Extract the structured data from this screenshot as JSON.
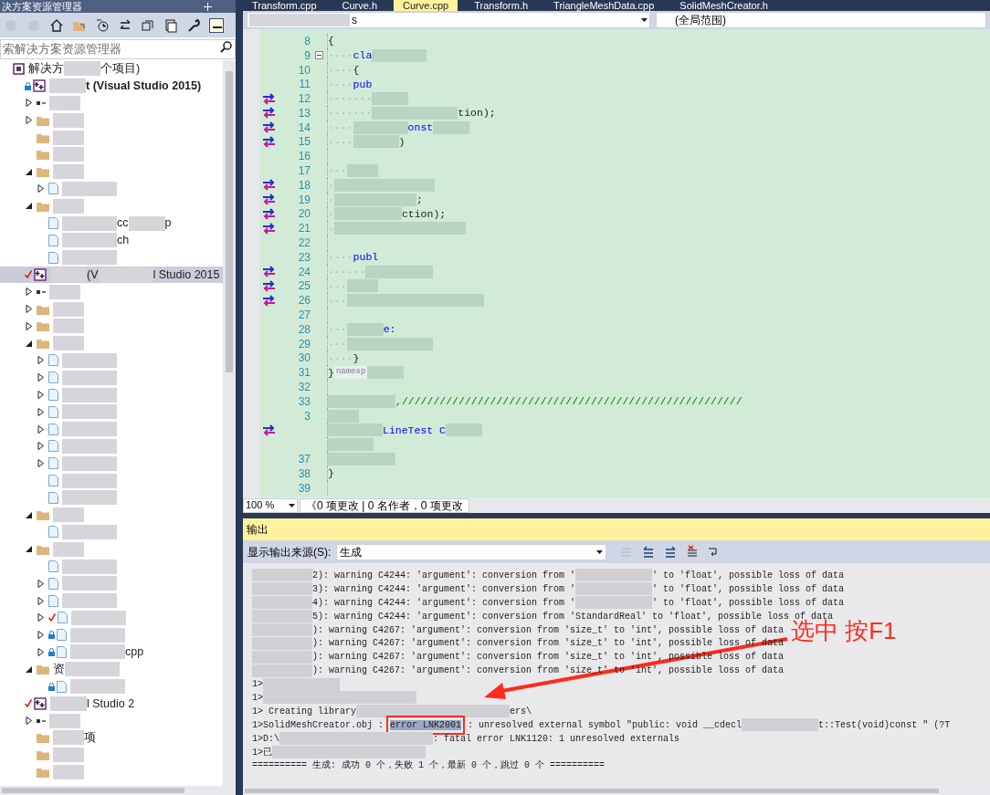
{
  "explorer": {
    "title": "决方案资源管理器",
    "search": {
      "placeholder": "索解决方案资源管理器"
    },
    "tree": [
      {
        "kind": "solution",
        "selected": false,
        "locked": false,
        "checked": false,
        "segments": [
          {
            "kind": "text",
            "text": "解决方"
          },
          {
            "kind": "redacted"
          },
          {
            "kind": "text",
            "text": "个项目)"
          }
        ],
        "children": [
          {
            "kind": "project",
            "locked": true,
            "checked": false,
            "bold": true,
            "selected": false,
            "segments": [
              {
                "kind": "redacted"
              },
              {
                "kind": "text",
                "text": "t (Visual Studio 2015)"
              }
            ],
            "children": [
              {
                "kind": "ref",
                "expanded": false,
                "selected": false,
                "locked": false,
                "checked": false,
                "segments": [
                  {
                    "kind": "redacted"
                  }
                ]
              },
              {
                "kind": "folder",
                "expanded": false,
                "selected": false,
                "locked": false,
                "checked": false,
                "segments": [
                  {
                    "kind": "redacted"
                  }
                ]
              },
              {
                "kind": "folder",
                "selected": false,
                "locked": false,
                "checked": false,
                "segments": [
                  {
                    "kind": "redacted"
                  }
                ]
              },
              {
                "kind": "folder",
                "selected": false,
                "locked": false,
                "checked": false,
                "segments": [
                  {
                    "kind": "redacted"
                  }
                ]
              },
              {
                "kind": "folder",
                "expanded": true,
                "selected": false,
                "locked": false,
                "checked": false,
                "segments": [
                  {
                    "kind": "redacted"
                  }
                ],
                "children": [
                  {
                    "kind": "file",
                    "expanded": false,
                    "selected": false,
                    "locked": false,
                    "checked": false,
                    "segments": [
                      {
                        "kind": "redacted"
                      }
                    ]
                  }
                ]
              },
              {
                "kind": "folder",
                "expanded": true,
                "selected": false,
                "locked": false,
                "checked": false,
                "segments": [
                  {
                    "kind": "redacted"
                  }
                ],
                "children": [
                  {
                    "kind": "file",
                    "selected": false,
                    "locked": false,
                    "checked": false,
                    "segments": [
                      {
                        "kind": "redacted"
                      },
                      {
                        "kind": "text",
                        "text": "cc"
                      },
                      {
                        "kind": "redacted"
                      },
                      {
                        "kind": "text",
                        "text": "p"
                      }
                    ]
                  },
                  {
                    "kind": "file",
                    "selected": false,
                    "locked": false,
                    "checked": false,
                    "segments": [
                      {
                        "kind": "redacted"
                      },
                      {
                        "kind": "text",
                        "text": "ch"
                      }
                    ]
                  },
                  {
                    "kind": "file",
                    "selected": false,
                    "locked": false,
                    "checked": false,
                    "segments": [
                      {
                        "kind": "redacted"
                      }
                    ]
                  }
                ]
              }
            ]
          },
          {
            "kind": "project",
            "locked": false,
            "checked": true,
            "bold": false,
            "selected": true,
            "segments": [
              {
                "kind": "redacted"
              },
              {
                "kind": "text",
                "text": "(V"
              },
              {
                "kind": "redacted"
              },
              {
                "kind": "text",
                "text": "l Studio 2015"
              }
            ],
            "children": [
              {
                "kind": "ref",
                "expanded": false,
                "selected": false,
                "locked": false,
                "checked": false,
                "segments": [
                  {
                    "kind": "redacted"
                  }
                ]
              },
              {
                "kind": "folder",
                "expanded": false,
                "selected": false,
                "locked": false,
                "checked": false,
                "segments": [
                  {
                    "kind": "redacted"
                  }
                ]
              },
              {
                "kind": "folder",
                "expanded": false,
                "selected": false,
                "locked": false,
                "checked": false,
                "segments": [
                  {
                    "kind": "redacted"
                  }
                ]
              },
              {
                "kind": "folder",
                "expanded": true,
                "selected": false,
                "locked": false,
                "checked": false,
                "segments": [
                  {
                    "kind": "redacted"
                  }
                ],
                "children": [
                  {
                    "kind": "file",
                    "expanded": false,
                    "selected": false,
                    "locked": false,
                    "checked": false,
                    "segments": [
                      {
                        "kind": "redacted"
                      }
                    ]
                  },
                  {
                    "kind": "file",
                    "expanded": false,
                    "selected": false,
                    "locked": false,
                    "checked": false,
                    "segments": [
                      {
                        "kind": "redacted"
                      }
                    ]
                  },
                  {
                    "kind": "file",
                    "expanded": false,
                    "selected": false,
                    "locked": false,
                    "checked": false,
                    "segments": [
                      {
                        "kind": "redacted"
                      }
                    ]
                  },
                  {
                    "kind": "file",
                    "expanded": false,
                    "selected": false,
                    "locked": false,
                    "checked": false,
                    "segments": [
                      {
                        "kind": "redacted"
                      }
                    ]
                  },
                  {
                    "kind": "file",
                    "expanded": false,
                    "selected": false,
                    "locked": false,
                    "checked": false,
                    "segments": [
                      {
                        "kind": "redacted"
                      }
                    ]
                  },
                  {
                    "kind": "file",
                    "expanded": false,
                    "selected": false,
                    "locked": false,
                    "checked": false,
                    "segments": [
                      {
                        "kind": "redacted"
                      }
                    ]
                  },
                  {
                    "kind": "file",
                    "expanded": false,
                    "selected": false,
                    "locked": false,
                    "checked": false,
                    "segments": [
                      {
                        "kind": "redacted"
                      }
                    ]
                  },
                  {
                    "kind": "file",
                    "selected": false,
                    "locked": false,
                    "checked": false,
                    "segments": [
                      {
                        "kind": "redacted"
                      }
                    ]
                  },
                  {
                    "kind": "file",
                    "selected": false,
                    "locked": false,
                    "checked": false,
                    "segments": [
                      {
                        "kind": "redacted"
                      }
                    ]
                  }
                ]
              },
              {
                "kind": "folder",
                "expanded": true,
                "selected": false,
                "locked": false,
                "checked": false,
                "segments": [
                  {
                    "kind": "redacted"
                  }
                ],
                "children": [
                  {
                    "kind": "file",
                    "selected": false,
                    "locked": false,
                    "checked": false,
                    "segments": [
                      {
                        "kind": "redacted"
                      }
                    ]
                  }
                ]
              },
              {
                "kind": "folder",
                "expanded": true,
                "selected": false,
                "locked": false,
                "checked": false,
                "segments": [
                  {
                    "kind": "redacted"
                  }
                ],
                "children": [
                  {
                    "kind": "file",
                    "selected": false,
                    "locked": false,
                    "checked": false,
                    "segments": [
                      {
                        "kind": "redacted"
                      }
                    ]
                  },
                  {
                    "kind": "file",
                    "expanded": false,
                    "selected": false,
                    "locked": false,
                    "checked": false,
                    "segments": [
                      {
                        "kind": "redacted"
                      }
                    ]
                  },
                  {
                    "kind": "file",
                    "expanded": false,
                    "selected": false,
                    "locked": false,
                    "checked": false,
                    "segments": [
                      {
                        "kind": "redacted"
                      }
                    ]
                  },
                  {
                    "kind": "file",
                    "expanded": false,
                    "checked": true,
                    "locked": false,
                    "selected": false,
                    "segments": [
                      {
                        "kind": "redacted"
                      }
                    ]
                  },
                  {
                    "kind": "file",
                    "expanded": false,
                    "locked": true,
                    "checked": false,
                    "selected": false,
                    "segments": [
                      {
                        "kind": "redacted"
                      }
                    ]
                  },
                  {
                    "kind": "file",
                    "expanded": false,
                    "locked": true,
                    "checked": false,
                    "selected": false,
                    "segments": [
                      {
                        "kind": "redacted"
                      },
                      {
                        "kind": "text",
                        "text": "cpp"
                      }
                    ]
                  }
                ]
              },
              {
                "kind": "folder",
                "expanded": true,
                "selected": false,
                "locked": false,
                "checked": false,
                "segments": [
                  {
                    "kind": "text",
                    "text": "资"
                  },
                  {
                    "kind": "redacted"
                  }
                ],
                "children": [
                  {
                    "kind": "file",
                    "locked": true,
                    "checked": false,
                    "selected": false,
                    "segments": [
                      {
                        "kind": "redacted"
                      }
                    ]
                  }
                ]
              }
            ]
          },
          {
            "kind": "project",
            "locked": false,
            "checked": true,
            "bold": false,
            "selected": false,
            "segments": [
              {
                "kind": "redacted"
              },
              {
                "kind": "text",
                "text": "l Studio 2"
              }
            ],
            "children": [
              {
                "kind": "ref",
                "expanded": false,
                "selected": false,
                "locked": false,
                "checked": false,
                "segments": [
                  {
                    "kind": "redacted"
                  }
                ]
              },
              {
                "kind": "folder",
                "selected": false,
                "locked": false,
                "checked": false,
                "segments": [
                  {
                    "kind": "redacted"
                  },
                  {
                    "kind": "text",
                    "text": "项"
                  }
                ]
              },
              {
                "kind": "folder",
                "selected": false,
                "locked": false,
                "checked": false,
                "segments": [
                  {
                    "kind": "redacted"
                  }
                ]
              },
              {
                "kind": "folder",
                "selected": false,
                "locked": false,
                "checked": false,
                "segments": [
                  {
                    "kind": "redacted"
                  }
                ]
              }
            ]
          }
        ]
      }
    ]
  },
  "editor": {
    "tabs": [
      {
        "label": "Transform.cpp",
        "selected": false
      },
      {
        "label": "Curve.h",
        "selected": false
      },
      {
        "label": "Curve.cpp",
        "selected": true
      },
      {
        "label": "Transform.h",
        "selected": false
      },
      {
        "label": "TriangleMeshData.cpp",
        "selected": false
      },
      {
        "label": "SolidMeshCreator.h",
        "selected": false
      }
    ],
    "nav": {
      "left": "s",
      "right": "(全局范围)"
    },
    "lines": [
      {
        "n": "8",
        "marker": false,
        "segments": [
          {
            "kind": "code",
            "text": "{"
          }
        ]
      },
      {
        "n": "9",
        "marker": false,
        "expanded": true,
        "segments": [
          {
            "kind": "dots",
            "text": "····"
          },
          {
            "kind": "keyword",
            "text": "cla"
          },
          {
            "kind": "redacted"
          }
        ]
      },
      {
        "n": "10",
        "marker": false,
        "segments": [
          {
            "kind": "dots",
            "text": "····"
          },
          {
            "kind": "code",
            "text": "{"
          }
        ]
      },
      {
        "n": "11",
        "marker": false,
        "segments": [
          {
            "kind": "dots",
            "text": "····"
          },
          {
            "kind": "keyword",
            "text": "pub"
          }
        ]
      },
      {
        "n": "12",
        "marker": true,
        "segments": [
          {
            "kind": "dots",
            "text": "·······"
          },
          {
            "kind": "redacted"
          }
        ]
      },
      {
        "n": "13",
        "marker": true,
        "segments": [
          {
            "kind": "dots",
            "text": "·······"
          },
          {
            "kind": "redacted"
          },
          {
            "kind": "redacted"
          },
          {
            "kind": "code",
            "text": "tion);"
          }
        ]
      },
      {
        "n": "14",
        "marker": true,
        "segments": [
          {
            "kind": "dots",
            "text": "····"
          },
          {
            "kind": "redacted"
          },
          {
            "kind": "keyword",
            "text": "onst"
          },
          {
            "kind": "redacted"
          }
        ]
      },
      {
        "n": "15",
        "marker": true,
        "segments": [
          {
            "kind": "dots",
            "text": "····"
          },
          {
            "kind": "redacted"
          },
          {
            "kind": "code",
            "text": ")"
          }
        ]
      },
      {
        "n": "16",
        "marker": false
      },
      {
        "n": "17",
        "marker": false,
        "segments": [
          {
            "kind": "dots",
            "text": "···"
          },
          {
            "kind": "redacted"
          }
        ]
      },
      {
        "n": "18",
        "marker": true,
        "segments": [
          {
            "kind": "dots",
            "text": "·"
          },
          {
            "kind": "redacted"
          },
          {
            "kind": "redacted"
          }
        ]
      },
      {
        "n": "19",
        "marker": true,
        "segments": [
          {
            "kind": "dots",
            "text": "·"
          },
          {
            "kind": "redacted"
          },
          {
            "kind": "redacted"
          },
          {
            "kind": "code",
            "text": ";"
          }
        ]
      },
      {
        "n": "20",
        "marker": true,
        "segments": [
          {
            "kind": "dots",
            "text": "·"
          },
          {
            "kind": "redacted"
          },
          {
            "kind": "redacted"
          },
          {
            "kind": "code",
            "text": "ction);"
          }
        ]
      },
      {
        "n": "21",
        "marker": true,
        "segments": [
          {
            "kind": "dots",
            "text": "·"
          },
          {
            "kind": "redacted"
          },
          {
            "kind": "redacted"
          },
          {
            "kind": "redacted"
          }
        ]
      },
      {
        "n": "22",
        "marker": false
      },
      {
        "n": "23",
        "marker": false,
        "segments": [
          {
            "kind": "dots",
            "text": "····"
          },
          {
            "kind": "keyword",
            "text": "publ"
          }
        ]
      },
      {
        "n": "24",
        "marker": true,
        "segments": [
          {
            "kind": "dots",
            "text": "······"
          },
          {
            "kind": "redacted"
          },
          {
            "kind": "redacted"
          }
        ]
      },
      {
        "n": "25",
        "marker": true,
        "segments": [
          {
            "kind": "dots",
            "text": "···"
          },
          {
            "kind": "redacted"
          }
        ]
      },
      {
        "n": "26",
        "marker": true,
        "segments": [
          {
            "kind": "dots",
            "text": "···"
          },
          {
            "kind": "redacted"
          },
          {
            "kind": "redacted"
          },
          {
            "kind": "redacted"
          }
        ]
      },
      {
        "n": "27",
        "marker": false
      },
      {
        "n": "28",
        "marker": false,
        "segments": [
          {
            "kind": "dots",
            "text": "···"
          },
          {
            "kind": "redacted"
          },
          {
            "kind": "keyword",
            "text": "e:"
          }
        ]
      },
      {
        "n": "29",
        "marker": false,
        "segments": [
          {
            "kind": "dots",
            "text": "···"
          },
          {
            "kind": "redacted"
          },
          {
            "kind": "redacted"
          }
        ]
      },
      {
        "n": "30",
        "marker": false,
        "segments": [
          {
            "kind": "dots",
            "text": "····"
          },
          {
            "kind": "code",
            "text": "}"
          }
        ]
      },
      {
        "n": "31",
        "marker": false,
        "segments": [
          {
            "kind": "code",
            "text": "}"
          },
          {
            "kind": "hint",
            "text": "namesp"
          },
          {
            "kind": "redacted"
          }
        ]
      },
      {
        "n": "32",
        "marker": false
      },
      {
        "n": "33",
        "marker": false,
        "segments": [
          {
            "kind": "redacted"
          },
          {
            "kind": "redacted"
          },
          {
            "kind": "comment",
            "text": ",//////////////////////////////////////////////////////"
          }
        ]
      },
      {
        "n": "3",
        "marker": false,
        "segments": [
          {
            "kind": "redacted"
          }
        ]
      },
      {
        "marker": true,
        "segments": [
          {
            "kind": "redacted"
          },
          {
            "kind": "keyword",
            "text": "LineTest C"
          },
          {
            "kind": "redacted"
          }
        ]
      },
      {
        "marker": false,
        "segments": [
          {
            "kind": "redacted"
          }
        ]
      },
      {
        "n": "37",
        "marker": false,
        "segments": [
          {
            "kind": "redacted"
          },
          {
            "kind": "redacted"
          }
        ]
      },
      {
        "n": "38",
        "marker": false,
        "segments": [
          {
            "kind": "code",
            "text": "}"
          }
        ]
      },
      {
        "n": "39",
        "marker": false
      }
    ],
    "zoom": "100 %",
    "changes": "《0 项更改 | 0 名作者，0 项更改"
  },
  "output": {
    "title": "输出",
    "source_label": "显示输出来源(S):",
    "source": "生成",
    "lines": [
      [
        {
          "kind": "redacted"
        },
        {
          "kind": "text",
          "text": "2): warning C4244: 'argument': conversion from '"
        },
        {
          "kind": "redacted"
        },
        {
          "kind": "text",
          "text": "' to 'float', possible loss of data"
        }
      ],
      [
        {
          "kind": "redacted"
        },
        {
          "kind": "text",
          "text": "3): warning C4244: 'argument': conversion from '"
        },
        {
          "kind": "redacted"
        },
        {
          "kind": "text",
          "text": "' to 'float', possible loss of data"
        }
      ],
      [
        {
          "kind": "redacted"
        },
        {
          "kind": "text",
          "text": "4): warning C4244: 'argument': conversion from '"
        },
        {
          "kind": "redacted"
        },
        {
          "kind": "text",
          "text": "' to 'float', possible loss of data"
        }
      ],
      [
        {
          "kind": "redacted"
        },
        {
          "kind": "text",
          "text": "5): warning C4244: 'argument': conversion from 'StandardReal' to 'float', possible loss of data"
        }
      ],
      [
        {
          "kind": "redacted"
        },
        {
          "kind": "text",
          "text": "): warning C4267: 'argument': conversion from 'size_t' to 'int', possible loss of data"
        }
      ],
      [
        {
          "kind": "redacted"
        },
        {
          "kind": "text",
          "text": "): warning C4267: 'argument': conversion from 'size_t' to 'int', possible loss of data"
        }
      ],
      [
        {
          "kind": "redacted"
        },
        {
          "kind": "text",
          "text": "): warning C4267: 'argument': conversion from 'size_t' to 'int', possible loss of data"
        }
      ],
      [
        {
          "kind": "redacted"
        },
        {
          "kind": "text",
          "text": "): warning C4267: 'argument': conversion from 'size_t' to 'int', possible loss of data"
        }
      ],
      [
        {
          "kind": "text",
          "text": "1>"
        },
        {
          "kind": "redacted"
        }
      ],
      [
        {
          "kind": "text",
          "text": "1>"
        },
        {
          "kind": "redacted"
        },
        {
          "kind": "redacted"
        }
      ],
      [
        {
          "kind": "text",
          "text": "1>   Creating library"
        },
        {
          "kind": "redacted"
        },
        {
          "kind": "redacted"
        },
        {
          "kind": "text",
          "text": "ers\\"
        }
      ],
      [
        {
          "kind": "text",
          "text": "1>SolidMeshCreator.obj : "
        },
        {
          "kind": "selected",
          "text": "error LNK2001"
        },
        {
          "kind": "text",
          "text": ": unresolved external symbol \"public: void __cdecl"
        },
        {
          "kind": "redacted"
        },
        {
          "kind": "text",
          "text": "t::Test(void)const \" (?T"
        }
      ],
      [
        {
          "kind": "text",
          "text": "1>D:\\"
        },
        {
          "kind": "redacted"
        },
        {
          "kind": "redacted"
        },
        {
          "kind": "text",
          "text": ": fatal error LNK1120: 1 unresolved externals"
        }
      ],
      [
        {
          "kind": "text",
          "text": "1>已"
        },
        {
          "kind": "redacted"
        },
        {
          "kind": "redacted"
        }
      ],
      [
        {
          "kind": "text",
          "text": "========== 生成: 成功 0 个，失败 1 个，最新 0 个，跳过 0 个 =========="
        }
      ]
    ]
  },
  "annotation": {
    "text": "选中 按F1"
  }
}
